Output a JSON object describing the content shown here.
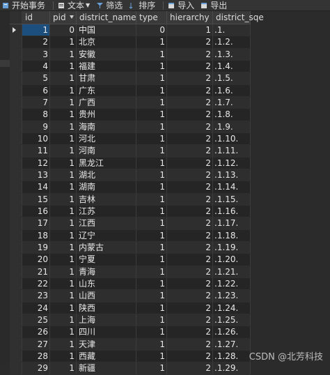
{
  "toolbar": {
    "begin_tx": "开始事务",
    "text": "文本",
    "filter": "筛选",
    "sort": "排序",
    "import": "导入",
    "export": "导出"
  },
  "columns": [
    "id",
    "pid",
    "district_name",
    "type",
    "hierarchy",
    "district_sqe"
  ],
  "rows": [
    {
      "id": "1",
      "pid": "0",
      "name": "中国",
      "type": "0",
      "hier": "1",
      "sqe": ".1."
    },
    {
      "id": "2",
      "pid": "1",
      "name": "北京",
      "type": "1",
      "hier": "2",
      "sqe": ".1.2."
    },
    {
      "id": "3",
      "pid": "1",
      "name": "安徽",
      "type": "1",
      "hier": "2",
      "sqe": ".1.3."
    },
    {
      "id": "4",
      "pid": "1",
      "name": "福建",
      "type": "1",
      "hier": "2",
      "sqe": ".1.4."
    },
    {
      "id": "5",
      "pid": "1",
      "name": "甘肃",
      "type": "1",
      "hier": "2",
      "sqe": ".1.5."
    },
    {
      "id": "6",
      "pid": "1",
      "name": "广东",
      "type": "1",
      "hier": "2",
      "sqe": ".1.6."
    },
    {
      "id": "7",
      "pid": "1",
      "name": "广西",
      "type": "1",
      "hier": "2",
      "sqe": ".1.7."
    },
    {
      "id": "8",
      "pid": "1",
      "name": "贵州",
      "type": "1",
      "hier": "2",
      "sqe": ".1.8."
    },
    {
      "id": "9",
      "pid": "1",
      "name": "海南",
      "type": "1",
      "hier": "2",
      "sqe": ".1.9."
    },
    {
      "id": "10",
      "pid": "1",
      "name": "河北",
      "type": "1",
      "hier": "2",
      "sqe": ".1.10."
    },
    {
      "id": "11",
      "pid": "1",
      "name": "河南",
      "type": "1",
      "hier": "2",
      "sqe": ".1.11."
    },
    {
      "id": "12",
      "pid": "1",
      "name": "黑龙江",
      "type": "1",
      "hier": "2",
      "sqe": ".1.12."
    },
    {
      "id": "13",
      "pid": "1",
      "name": "湖北",
      "type": "1",
      "hier": "2",
      "sqe": ".1.13."
    },
    {
      "id": "14",
      "pid": "1",
      "name": "湖南",
      "type": "1",
      "hier": "2",
      "sqe": ".1.14."
    },
    {
      "id": "15",
      "pid": "1",
      "name": "吉林",
      "type": "1",
      "hier": "2",
      "sqe": ".1.15."
    },
    {
      "id": "16",
      "pid": "1",
      "name": "江苏",
      "type": "1",
      "hier": "2",
      "sqe": ".1.16."
    },
    {
      "id": "17",
      "pid": "1",
      "name": "江西",
      "type": "1",
      "hier": "2",
      "sqe": ".1.17."
    },
    {
      "id": "18",
      "pid": "1",
      "name": "辽宁",
      "type": "1",
      "hier": "2",
      "sqe": ".1.18."
    },
    {
      "id": "19",
      "pid": "1",
      "name": "内蒙古",
      "type": "1",
      "hier": "2",
      "sqe": ".1.19."
    },
    {
      "id": "20",
      "pid": "1",
      "name": "宁夏",
      "type": "1",
      "hier": "2",
      "sqe": ".1.20."
    },
    {
      "id": "21",
      "pid": "1",
      "name": "青海",
      "type": "1",
      "hier": "2",
      "sqe": ".1.21."
    },
    {
      "id": "22",
      "pid": "1",
      "name": "山东",
      "type": "1",
      "hier": "2",
      "sqe": ".1.22."
    },
    {
      "id": "23",
      "pid": "1",
      "name": "山西",
      "type": "1",
      "hier": "2",
      "sqe": ".1.23."
    },
    {
      "id": "24",
      "pid": "1",
      "name": "陕西",
      "type": "1",
      "hier": "2",
      "sqe": ".1.24."
    },
    {
      "id": "25",
      "pid": "1",
      "name": "上海",
      "type": "1",
      "hier": "2",
      "sqe": ".1.25."
    },
    {
      "id": "26",
      "pid": "1",
      "name": "四川",
      "type": "1",
      "hier": "2",
      "sqe": ".1.26."
    },
    {
      "id": "27",
      "pid": "1",
      "name": "天津",
      "type": "1",
      "hier": "2",
      "sqe": ".1.27."
    },
    {
      "id": "28",
      "pid": "1",
      "name": "西藏",
      "type": "1",
      "hier": "2",
      "sqe": ".1.28."
    },
    {
      "id": "29",
      "pid": "1",
      "name": "新疆",
      "type": "1",
      "hier": "2",
      "sqe": ".1.29."
    }
  ],
  "watermark": "CSDN @北芳科技",
  "colors": {
    "selected_cell": "#1c4f7e",
    "background": "#2b2b2b",
    "header": "#3a3a3a"
  }
}
